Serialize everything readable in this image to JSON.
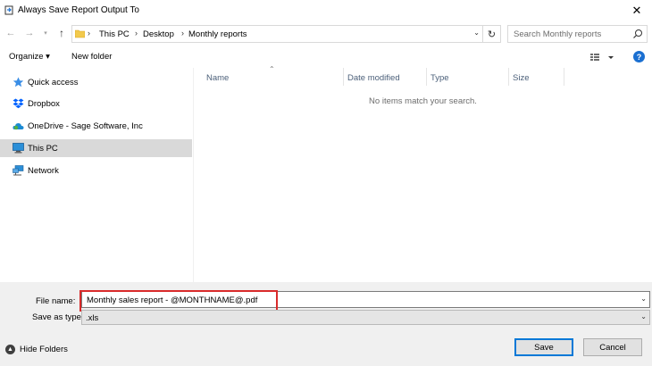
{
  "window": {
    "title": "Always Save Report Output To",
    "close_glyph": "✕"
  },
  "address": {
    "crumbs": [
      "This PC",
      "Desktop",
      "Monthly reports"
    ],
    "search_placeholder": "Search Monthly reports"
  },
  "toolbar": {
    "organize_label": "Organize ▾",
    "new_folder_label": "New folder",
    "help_label": "?"
  },
  "sidebar": {
    "items": [
      {
        "label": "Quick access",
        "icon": "star-icon"
      },
      {
        "label": "Dropbox",
        "icon": "dropbox-icon"
      },
      {
        "label": "OneDrive - Sage Software, Inc",
        "icon": "cloud-icon"
      },
      {
        "label": "This PC",
        "icon": "computer-icon",
        "selected": true
      },
      {
        "label": "Network",
        "icon": "network-icon"
      }
    ]
  },
  "file_list": {
    "columns": [
      "Name",
      "Date modified",
      "Type",
      "Size"
    ],
    "empty_message": "No items match your search."
  },
  "form": {
    "file_name_label": "File name:",
    "file_name_value": "Monthly sales report - @MONTHNAME@.pdf",
    "save_type_label": "Save as type:",
    "save_type_value": ".xls"
  },
  "footer": {
    "hide_folders_label": "Hide Folders",
    "save_label": "Save",
    "cancel_label": "Cancel"
  },
  "colors": {
    "highlight": "#d92b2b",
    "accent": "#0078d7",
    "selected_bg": "#d9d9d9"
  }
}
